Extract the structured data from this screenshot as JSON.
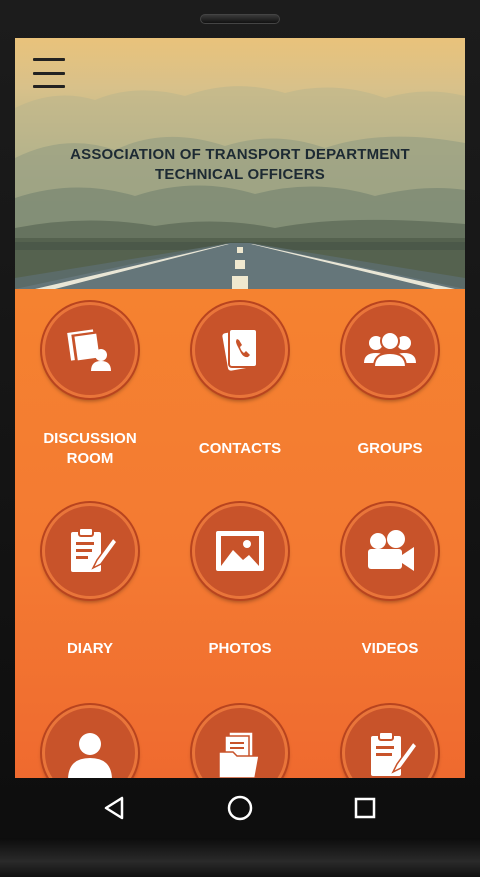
{
  "app": {
    "title": "ASSOCIATION OF TRANSPORT DEPARTMENT TECHNICAL OFFICERS",
    "title_line1": "ASSOCIATION OF TRANSPORT DEPARTMENT",
    "title_line2": "TECHNICAL OFFICERS"
  },
  "header": {
    "menu_icon": "hamburger-menu-icon"
  },
  "tiles": [
    {
      "label_line1": "DISCUSSION",
      "label_line2": "ROOM",
      "icon": "discussion-room-icon"
    },
    {
      "label_line1": "CONTACTS",
      "label_line2": "",
      "icon": "contacts-icon"
    },
    {
      "label_line1": "GROUPS",
      "label_line2": "",
      "icon": "groups-icon"
    },
    {
      "label_line1": "DIARY",
      "label_line2": "",
      "icon": "diary-icon"
    },
    {
      "label_line1": "PHOTOS",
      "label_line2": "",
      "icon": "photos-icon"
    },
    {
      "label_line1": "VIDEOS",
      "label_line2": "",
      "icon": "videos-icon"
    },
    {
      "label_line1": "",
      "label_line2": "",
      "icon": "profile-icon"
    },
    {
      "label_line1": "",
      "label_line2": "",
      "icon": "documents-icon"
    },
    {
      "label_line1": "",
      "label_line2": "",
      "icon": "notes-icon"
    }
  ],
  "navbar": {
    "back_icon": "back-triangle-icon",
    "home_icon": "home-circle-icon",
    "recents_icon": "recents-square-icon"
  },
  "colors": {
    "accent": "#f47a32",
    "circle": "#c8532a",
    "title_text": "#1d2a33"
  }
}
